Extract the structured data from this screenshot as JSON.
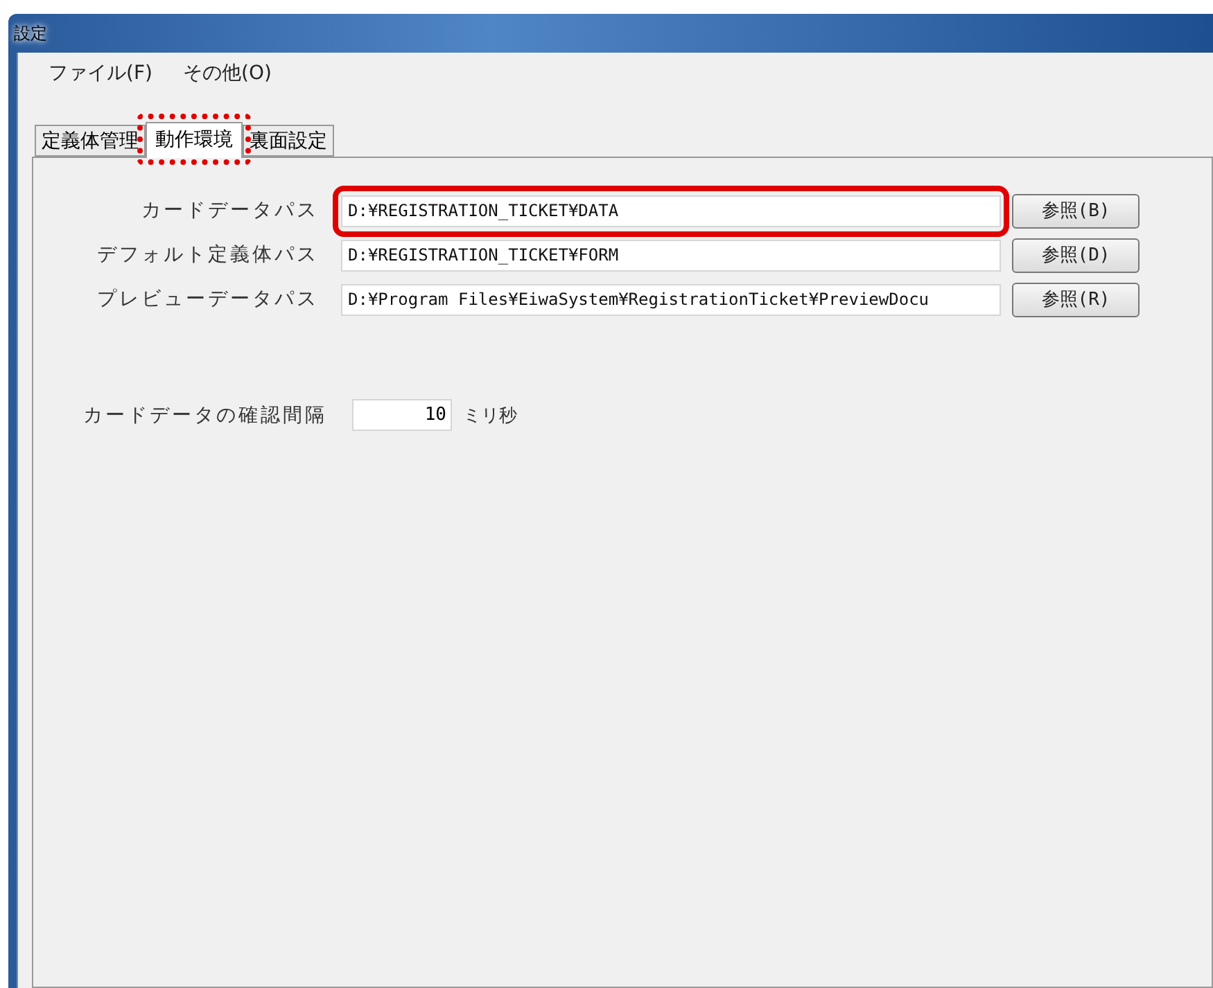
{
  "window": {
    "title": "設定"
  },
  "menu": [
    "ファイル(F)",
    "その他(O)"
  ],
  "tabs": [
    {
      "label": "定義体管理",
      "selected": false,
      "highlighted": false
    },
    {
      "label": "動作環境",
      "selected": true,
      "highlighted": true
    },
    {
      "label": "裏面設定",
      "selected": false,
      "highlighted": false
    }
  ],
  "paths": [
    {
      "label": "カードデータパス",
      "value": "D:¥REGISTRATION_TICKET¥DATA",
      "button": "参照(B)",
      "highlighted": true
    },
    {
      "label": "デフォルト定義体パス",
      "value": "D:¥REGISTRATION_TICKET¥FORM",
      "button": "参照(D)",
      "highlighted": false
    },
    {
      "label": "プレビューデータパス",
      "value": "D:¥Program Files¥EiwaSystem¥RegistrationTicket¥PreviewDocu",
      "button": "参照(R)",
      "highlighted": false
    }
  ],
  "interval": {
    "label": "カードデータの確認間隔",
    "value": "10",
    "unit": "ミリ秒"
  }
}
